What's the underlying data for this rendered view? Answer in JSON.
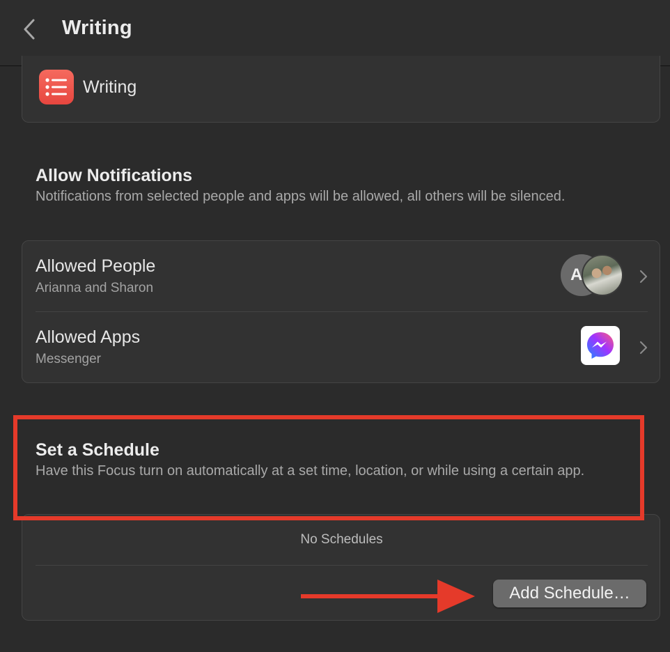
{
  "header": {
    "title": "Writing",
    "back_icon": "chevron-left-icon"
  },
  "focus_card": {
    "app_icon": "list-icon",
    "app_name": "Writing",
    "icon_color": "#f05a4f"
  },
  "allow_notifications": {
    "title": "Allow Notifications",
    "description": "Notifications from selected people and apps will be allowed, all others will be silenced.",
    "rows": [
      {
        "label": "Allowed People",
        "sub": "Arianna and Sharon",
        "avatar_initial": "A",
        "icon": "people-avatars-icon"
      },
      {
        "label": "Allowed Apps",
        "sub": "Messenger",
        "icon": "messenger-icon"
      }
    ]
  },
  "schedule": {
    "title": "Set a Schedule",
    "description": "Have this Focus turn on automatically at a set time, location, or while using a certain app.",
    "empty_text": "No Schedules",
    "add_button": "Add Schedule…"
  },
  "annotations": {
    "highlight_color": "#e53a2a",
    "arrow_color": "#e53a2a"
  }
}
